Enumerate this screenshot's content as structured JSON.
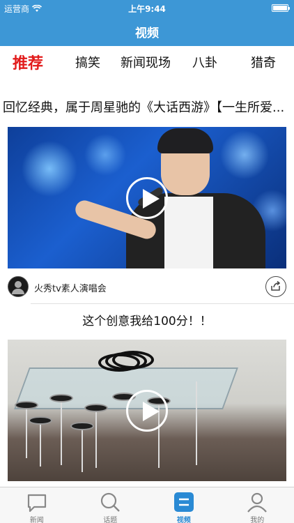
{
  "status_bar": {
    "carrier": "运营商",
    "time": "上午9:44"
  },
  "nav": {
    "title": "视频"
  },
  "category_tabs": [
    {
      "label": "推荐",
      "active": true
    },
    {
      "label": "搞笑",
      "active": false
    },
    {
      "label": "新闻现场",
      "active": false
    },
    {
      "label": "八卦",
      "active": false
    },
    {
      "label": "猎奇",
      "active": false
    }
  ],
  "feed": {
    "headline": "回忆经典，属于周星驰的《大话西游》【一生所爱...",
    "cards": [
      {
        "channel": "火秀tv素人演唱会"
      },
      {
        "title": "这个创意我给100分！！"
      }
    ]
  },
  "tab_bar": {
    "items": [
      {
        "label": "新闻",
        "icon": "chat-bubble-icon",
        "active": false
      },
      {
        "label": "话题",
        "icon": "search-icon",
        "active": false
      },
      {
        "label": "视频",
        "icon": "video-list-icon",
        "active": true
      },
      {
        "label": "我的",
        "icon": "user-icon",
        "active": false
      }
    ]
  },
  "colors": {
    "header_blue": "#3d97d6",
    "active_tab_red": "#e21b1b",
    "tab_active_blue": "#2a8ad4"
  }
}
